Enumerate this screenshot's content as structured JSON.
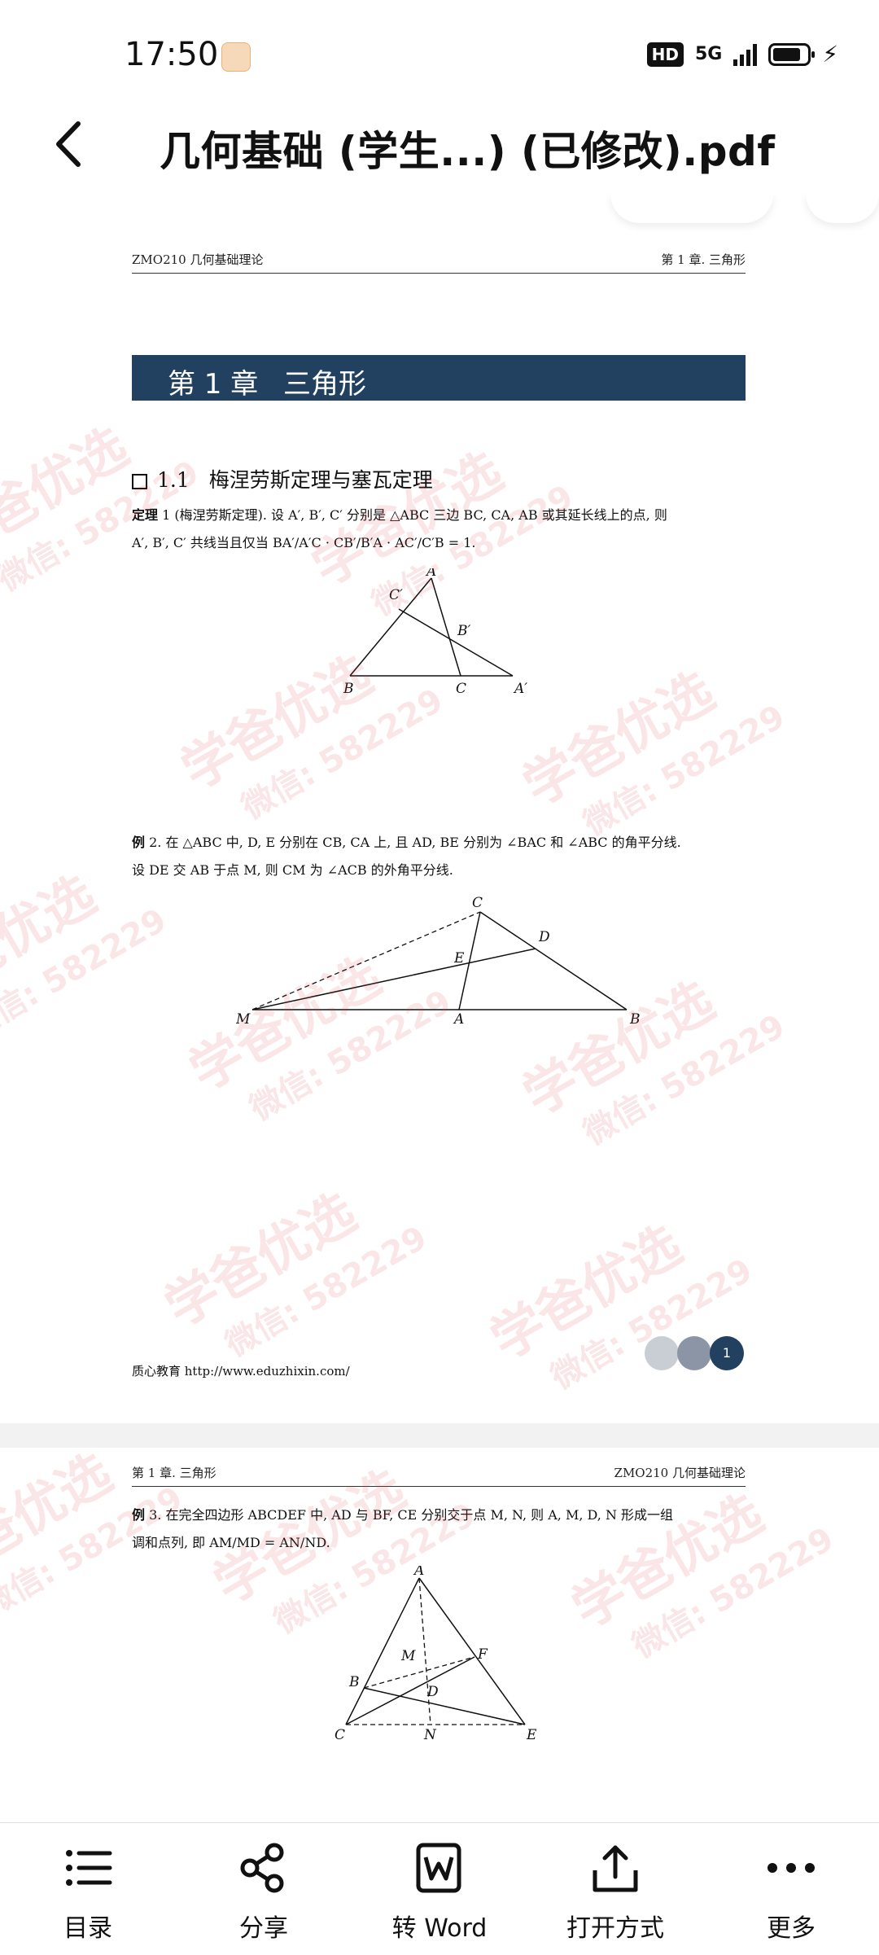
{
  "status": {
    "time": "17:50",
    "hd": "HD",
    "network": "5G"
  },
  "header": {
    "title": "几何基础 (学生...) (已修改).pdf"
  },
  "page1": {
    "running_left": "ZMO210 几何基础理论",
    "running_right": "第 1 章. 三角形",
    "chapter_num": "第 1 章",
    "chapter_name": "三角形",
    "section_num": "1.1",
    "section_title": "梅涅劳斯定理与塞瓦定理",
    "theorem_label": "定理",
    "theorem_text": "1 (梅涅劳斯定理). 设 A′, B′, C′ 分别是 △ABC 三边 BC, CA, AB 或其延长线上的点, 则",
    "theorem_text2": "A′, B′, C′ 共线当且仅当 BA′/A′C · CB′/B′A · AC′/C′B = 1.",
    "fig1": {
      "A": "A",
      "B": "B",
      "C": "C",
      "A1": "A′",
      "B1": "B′",
      "C1": "C′"
    },
    "example2_label": "例",
    "example2_text": "2. 在 △ABC 中, D, E 分别在 CB, CA 上, 且 AD, BE 分别为 ∠BAC 和 ∠ABC 的角平分线.",
    "example2_text2": "设 DE 交 AB 于点 M, 则 CM 为 ∠ACB 的外角平分线.",
    "fig2": {
      "C": "C",
      "D": "D",
      "E": "E",
      "M": "M",
      "A": "A",
      "B": "B"
    },
    "footer_text": "质心教育 http://www.eduzhixin.com/",
    "page_number": "1"
  },
  "page2": {
    "running_left": "第 1 章. 三角形",
    "running_right": "ZMO210 几何基础理论",
    "example3_label": "例",
    "example3_text": "3. 在完全四边形 ABCDEF 中, AD 与 BF, CE 分别交于点 M, N, 则 A, M, D, N 形成一组",
    "example3_text2": "调和点列, 即 AM/MD = AN/ND.",
    "fig3": {
      "A": "A",
      "M": "M",
      "F": "F",
      "B": "B",
      "D": "D",
      "C": "C",
      "N": "N",
      "E": "E"
    }
  },
  "watermark": {
    "main": "学爸优选",
    "sub": "微信: 582229"
  },
  "toolbar": {
    "items": [
      {
        "label": "目录",
        "icon": "list-icon"
      },
      {
        "label": "分享",
        "icon": "share-icon"
      },
      {
        "label": "转 Word",
        "icon": "word-icon"
      },
      {
        "label": "打开方式",
        "icon": "open-with-icon"
      },
      {
        "label": "更多",
        "icon": "more-icon"
      }
    ]
  }
}
